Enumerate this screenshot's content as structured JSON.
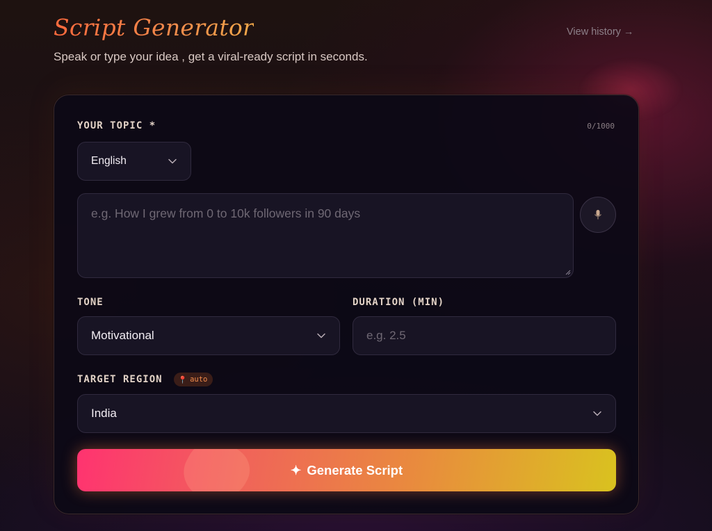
{
  "header": {
    "title": "Script Generator",
    "subtitle": "Speak or type your idea , get a viral-ready script in seconds.",
    "history_link": "View history →"
  },
  "form": {
    "topic": {
      "label": "YOUR TOPIC *",
      "counter": "0/1000",
      "language": "English",
      "placeholder": "e.g. How I grew from 0 to 10k followers in 90 days",
      "value": ""
    },
    "tone": {
      "label": "TONE",
      "value": "Motivational"
    },
    "duration": {
      "label": "DURATION (MIN)",
      "placeholder": "e.g. 2.5",
      "value": ""
    },
    "region": {
      "label": "TARGET REGION",
      "badge_icon": "📍",
      "badge": "auto",
      "value": "India"
    },
    "generate": {
      "icon": "✦",
      "label": "Generate Script"
    }
  },
  "icons": {
    "mic": "microphone-icon",
    "chevron": "chevron-down-icon",
    "pin": "pin-icon",
    "sparkle": "sparkle-icon"
  },
  "colors": {
    "accent_start": "#ff3370",
    "accent_end": "#d9c21f",
    "title_gradient": "#ff6a3d",
    "card_bg": "#0c0916",
    "field_bg": "#181424"
  }
}
